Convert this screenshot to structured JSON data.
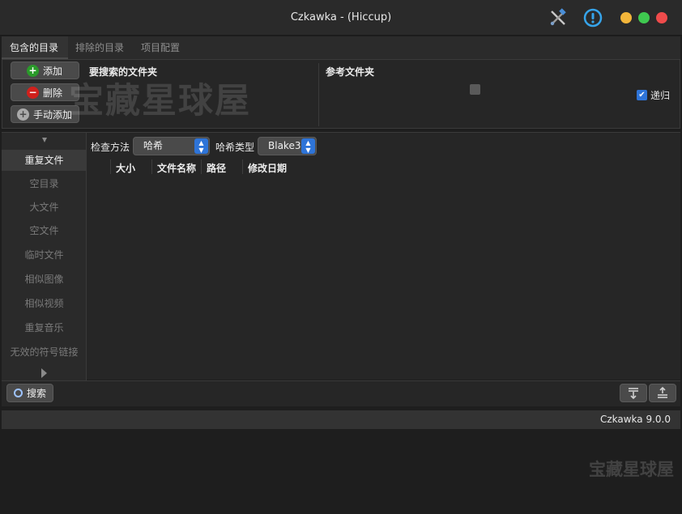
{
  "window": {
    "title": "Czkawka - (Hiccup)"
  },
  "toolbar_icons": [
    "tools-icon",
    "info-icon"
  ],
  "tabs": [
    {
      "label": "包含的目录"
    },
    {
      "label": "排除的目录"
    },
    {
      "label": "项目配置"
    }
  ],
  "directories": {
    "add_label": "添加",
    "remove_label": "删除",
    "manual_add_label": "手动添加",
    "search_folders_header": "要搜索的文件夹",
    "reference_folders_header": "参考文件夹",
    "recursive_label": "递归"
  },
  "sidebar": {
    "items": [
      {
        "label": "重复文件"
      },
      {
        "label": "空目录"
      },
      {
        "label": "大文件"
      },
      {
        "label": "空文件"
      },
      {
        "label": "临时文件"
      },
      {
        "label": "相似图像"
      },
      {
        "label": "相似视频"
      },
      {
        "label": "重复音乐"
      },
      {
        "label": "无效的符号链接"
      }
    ]
  },
  "options": {
    "check_method_label": "检查方法",
    "check_method_value": "哈希",
    "hash_type_label": "哈希类型",
    "hash_type_value": "Blake3"
  },
  "table": {
    "columns": [
      "大小",
      "文件名称",
      "路径",
      "修改日期"
    ]
  },
  "bottom": {
    "search_label": "搜索"
  },
  "status": {
    "version": "Czkawka 9.0.0"
  },
  "watermark": "宝藏星球屋",
  "colors": {
    "accent": "#2e74d8",
    "add_green": "#2a9a2a",
    "remove_red": "#d0201c",
    "win_close": "#ef4b4b",
    "win_min": "#f2b53a",
    "win_max": "#3fc950"
  }
}
